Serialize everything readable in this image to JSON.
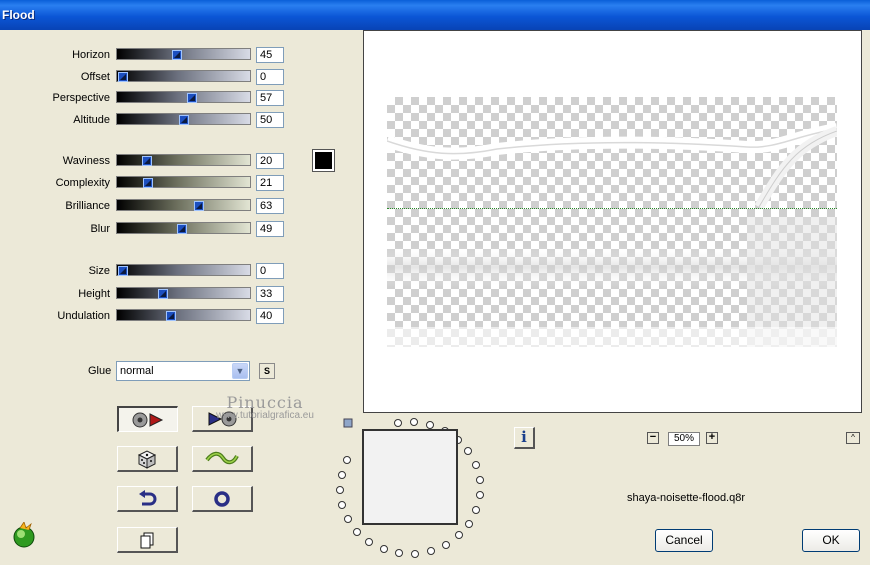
{
  "window": {
    "title": "Flood"
  },
  "params_group1": [
    {
      "label": "Horizon",
      "value": "45",
      "pos": 45
    },
    {
      "label": "Offset",
      "value": "0",
      "pos": 0
    },
    {
      "label": "Perspective",
      "value": "57",
      "pos": 57
    },
    {
      "label": "Altitude",
      "value": "50",
      "pos": 50
    }
  ],
  "params_group2": [
    {
      "label": "Waviness",
      "value": "20",
      "pos": 20
    },
    {
      "label": "Complexity",
      "value": "21",
      "pos": 21
    },
    {
      "label": "Brilliance",
      "value": "63",
      "pos": 63
    },
    {
      "label": "Blur",
      "value": "49",
      "pos": 49
    }
  ],
  "params_group3": [
    {
      "label": "Size",
      "value": "0",
      "pos": 0
    },
    {
      "label": "Height",
      "value": "33",
      "pos": 33
    },
    {
      "label": "Undulation",
      "value": "40",
      "pos": 40
    }
  ],
  "color": {
    "swatch": "#000000"
  },
  "glue": {
    "label": "Glue",
    "value": "normal",
    "s_label": "S"
  },
  "toolbar": {
    "buttons": [
      "preview-toggle",
      "compare",
      "random",
      "wave-preset",
      "undo",
      "reset",
      "copy"
    ]
  },
  "watermark": {
    "line1": "Pinuccia",
    "line2": "www.tutorialgrafica.eu"
  },
  "preview": {
    "zoom": "50%",
    "zoom_out": "−",
    "zoom_in": "+",
    "collapse": "^"
  },
  "info": {
    "label": "i"
  },
  "preset": {
    "filename": "shaya-noisette-flood.q8r"
  },
  "buttons": {
    "cancel": "Cancel",
    "ok": "OK"
  }
}
